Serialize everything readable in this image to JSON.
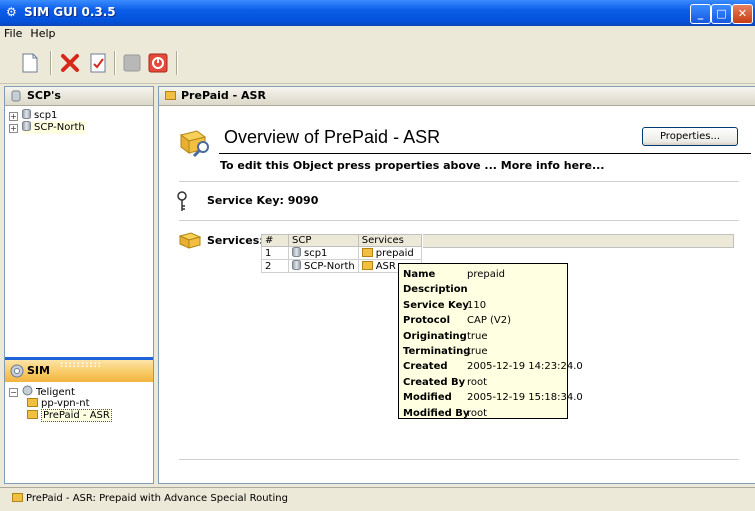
{
  "window": {
    "title": "SIM GUI 0.3.5",
    "icon": "app-icon",
    "controls": [
      "minimize",
      "maximize",
      "close"
    ]
  },
  "menu": {
    "items": [
      "File",
      "Help"
    ]
  },
  "toolbar": {
    "buttons": [
      "new-icon",
      "delete-icon",
      "edit-icon",
      "disabled-icon",
      "stop-icon"
    ]
  },
  "scp_panel": {
    "title": "SCP's",
    "items": [
      {
        "label": "scp1"
      },
      {
        "label": "SCP-North"
      }
    ]
  },
  "sim_panel": {
    "title": "SIM",
    "root": "Teligent",
    "children": [
      {
        "label": "pp-vpn-nt"
      },
      {
        "label": "PrePaid - ASR"
      }
    ]
  },
  "main": {
    "tab_title": "PrePaid - ASR",
    "heading": "Overview of PrePaid - ASR",
    "subheading": "To edit this Object press properties above ... More info here...",
    "properties_button": "Properties...",
    "service_key": "Service Key: 9090",
    "services_label": "Services:",
    "table": {
      "headers": [
        "#",
        "SCP",
        "Services"
      ],
      "rows": [
        {
          "num": "1",
          "scp": "scp1",
          "service": "prepaid"
        },
        {
          "num": "2",
          "scp": "SCP-North",
          "service": "ASR"
        }
      ]
    }
  },
  "tooltip": {
    "rows": [
      {
        "key": "Name",
        "value": "prepaid"
      },
      {
        "key": "Description",
        "value": ""
      },
      {
        "key": "Service Key",
        "value": "110"
      },
      {
        "key": "Protocol",
        "value": "CAP (V2)"
      },
      {
        "key": "Originating",
        "value": "true"
      },
      {
        "key": "Terminating",
        "value": "true"
      },
      {
        "key": "Created",
        "value": "2005-12-19 14:23:24.0"
      },
      {
        "key": "Created By",
        "value": "root"
      },
      {
        "key": "Modified",
        "value": "2005-12-19 15:18:34.0"
      },
      {
        "key": "Modified By",
        "value": "root"
      }
    ]
  },
  "statusbar": {
    "text": "PrePaid - ASR: Prepaid with Advance Special Routing"
  }
}
